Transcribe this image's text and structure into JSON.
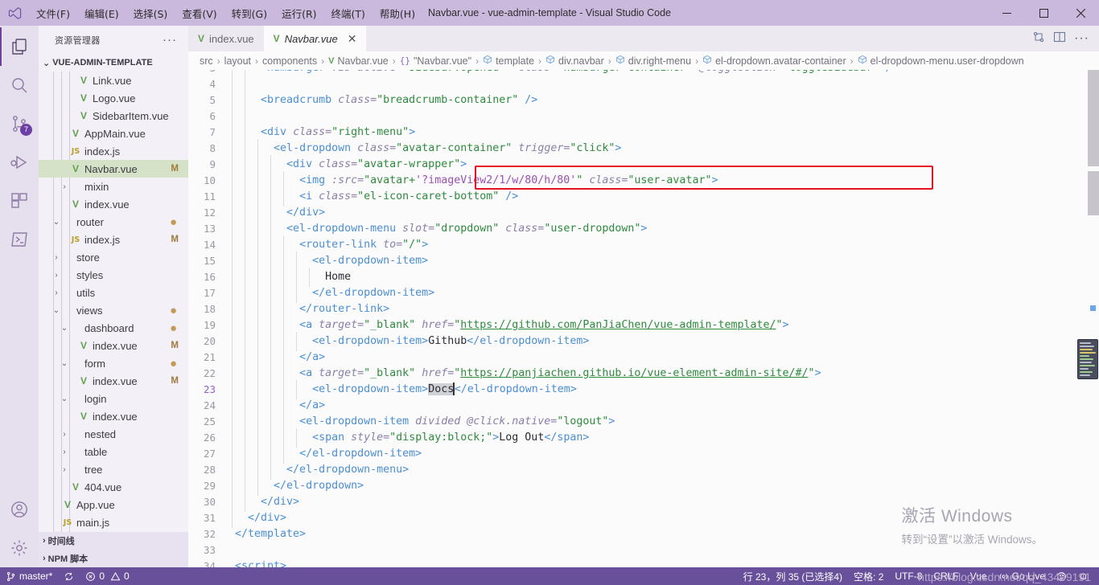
{
  "window": {
    "title": "Navbar.vue - vue-admin-template - Visual Studio Code",
    "minimize_label": "–",
    "maximize_label": "❐",
    "close_label": "✕"
  },
  "menubar": {
    "items": [
      {
        "label": "文件(F)"
      },
      {
        "label": "编辑(E)"
      },
      {
        "label": "选择(S)"
      },
      {
        "label": "查看(V)"
      },
      {
        "label": "转到(G)"
      },
      {
        "label": "运行(R)"
      },
      {
        "label": "终端(T)"
      },
      {
        "label": "帮助(H)"
      }
    ]
  },
  "activitybar": {
    "items": [
      {
        "name": "explorer-icon",
        "badge": ""
      },
      {
        "name": "search-icon",
        "badge": ""
      },
      {
        "name": "source-control-icon",
        "badge": "7"
      },
      {
        "name": "run-debug-icon",
        "badge": ""
      },
      {
        "name": "extensions-icon",
        "badge": ""
      },
      {
        "name": "remote-terminal-icon",
        "badge": ""
      }
    ],
    "bottom": [
      {
        "name": "accounts-icon"
      },
      {
        "name": "settings-gear-icon"
      }
    ]
  },
  "sidebar": {
    "header": "资源管理器",
    "header_more": "···",
    "project": "VUE-ADMIN-TEMPLATE",
    "tree": [
      {
        "label": "Link.vue",
        "icon": "vue",
        "indent": 3,
        "twisty": "",
        "status": "",
        "selected": false
      },
      {
        "label": "Logo.vue",
        "icon": "vue",
        "indent": 3,
        "twisty": "",
        "status": "",
        "selected": false
      },
      {
        "label": "SidebarItem.vue",
        "icon": "vue",
        "indent": 3,
        "twisty": "",
        "status": "",
        "selected": false
      },
      {
        "label": "AppMain.vue",
        "icon": "vue",
        "indent": 2,
        "twisty": "",
        "status": "",
        "selected": false
      },
      {
        "label": "index.js",
        "icon": "js",
        "indent": 2,
        "twisty": "",
        "status": "",
        "selected": false
      },
      {
        "label": "Navbar.vue",
        "icon": "vue",
        "indent": 2,
        "twisty": "",
        "status": "M",
        "selected": true
      },
      {
        "label": "mixin",
        "icon": "",
        "indent": 2,
        "twisty": ">",
        "status": "",
        "selected": false
      },
      {
        "label": "index.vue",
        "icon": "vue",
        "indent": 2,
        "twisty": "",
        "status": "",
        "selected": false
      },
      {
        "label": "router",
        "icon": "",
        "indent": 1,
        "twisty": "v",
        "status": "●",
        "selected": false
      },
      {
        "label": "index.js",
        "icon": "js",
        "indent": 2,
        "twisty": "",
        "status": "M",
        "selected": false
      },
      {
        "label": "store",
        "icon": "",
        "indent": 1,
        "twisty": ">",
        "status": "",
        "selected": false
      },
      {
        "label": "styles",
        "icon": "",
        "indent": 1,
        "twisty": ">",
        "status": "",
        "selected": false
      },
      {
        "label": "utils",
        "icon": "",
        "indent": 1,
        "twisty": ">",
        "status": "",
        "selected": false
      },
      {
        "label": "views",
        "icon": "",
        "indent": 1,
        "twisty": "v",
        "status": "●",
        "selected": false
      },
      {
        "label": "dashboard",
        "icon": "",
        "indent": 2,
        "twisty": "v",
        "status": "●",
        "selected": false
      },
      {
        "label": "index.vue",
        "icon": "vue",
        "indent": 3,
        "twisty": "",
        "status": "M",
        "selected": false
      },
      {
        "label": "form",
        "icon": "",
        "indent": 2,
        "twisty": "v",
        "status": "●",
        "selected": false
      },
      {
        "label": "index.vue",
        "icon": "vue",
        "indent": 3,
        "twisty": "",
        "status": "M",
        "selected": false
      },
      {
        "label": "login",
        "icon": "",
        "indent": 2,
        "twisty": "v",
        "status": "",
        "selected": false
      },
      {
        "label": "index.vue",
        "icon": "vue",
        "indent": 3,
        "twisty": "",
        "status": "",
        "selected": false
      },
      {
        "label": "nested",
        "icon": "",
        "indent": 2,
        "twisty": ">",
        "status": "",
        "selected": false
      },
      {
        "label": "table",
        "icon": "",
        "indent": 2,
        "twisty": ">",
        "status": "",
        "selected": false
      },
      {
        "label": "tree",
        "icon": "",
        "indent": 2,
        "twisty": ">",
        "status": "",
        "selected": false
      },
      {
        "label": "404.vue",
        "icon": "vue",
        "indent": 2,
        "twisty": "",
        "status": "",
        "selected": false
      },
      {
        "label": "App.vue",
        "icon": "vue",
        "indent": 1,
        "twisty": "",
        "status": "",
        "selected": false
      },
      {
        "label": "main.js",
        "icon": "js",
        "indent": 1,
        "twisty": "",
        "status": "",
        "selected": false
      }
    ],
    "sections_bottom": [
      {
        "label": "时间线",
        "twisty": ">"
      },
      {
        "label": "NPM 脚本",
        "twisty": ">"
      }
    ]
  },
  "tabs": {
    "items": [
      {
        "label": "index.vue",
        "icon": "vue",
        "active": false,
        "closable": false
      },
      {
        "label": "Navbar.vue",
        "icon": "vue",
        "active": true,
        "closable": true,
        "close": "✕"
      }
    ],
    "actions": [
      {
        "name": "split-compare-icon"
      },
      {
        "name": "split-editor-icon"
      },
      {
        "name": "editor-more-actions",
        "label": "···"
      }
    ]
  },
  "breadcrumbs": {
    "sep": "›",
    "items": [
      {
        "label": "src",
        "sym": ""
      },
      {
        "label": "layout",
        "sym": ""
      },
      {
        "label": "components",
        "sym": ""
      },
      {
        "label": "Navbar.vue",
        "sym": "vue"
      },
      {
        "label": "\"Navbar.vue\"",
        "sym": "brace"
      },
      {
        "label": "template",
        "sym": "cube"
      },
      {
        "label": "div.navbar",
        "sym": "cube"
      },
      {
        "label": "div.right-menu",
        "sym": "cube"
      },
      {
        "label": "el-dropdown.avatar-container",
        "sym": "cube"
      },
      {
        "label": "el-dropdown-menu.user-dropdown",
        "sym": "cube"
      }
    ]
  },
  "editor": {
    "first_visible_line": 3,
    "highlight_box": {
      "line": 10,
      "label": "highlighted-img-line"
    },
    "lines": [
      {
        "n": 3,
        "indent": 2,
        "partial": true,
        "tokens": [
          {
            "t": "<hamburger ",
            "c": "kw-tag"
          },
          {
            "t": ":is-active=",
            "c": "kw-attr"
          },
          {
            "t": "\"sidebar.opened\"",
            "c": "kw-str"
          },
          {
            "t": "  ",
            "c": "kw-text"
          },
          {
            "t": "class=",
            "c": "kw-attr"
          },
          {
            "t": "\"hamburger-container\"",
            "c": "kw-str"
          },
          {
            "t": " ",
            "c": "kw-text"
          },
          {
            "t": "@toggleClick=",
            "c": "kw-attr"
          },
          {
            "t": "\"toggleSidebar\"",
            "c": "kw-str"
          },
          {
            "t": " />",
            "c": "kw-tag"
          }
        ]
      },
      {
        "n": 4,
        "indent": 2,
        "tokens": []
      },
      {
        "n": 5,
        "indent": 2,
        "tokens": [
          {
            "t": "<breadcrumb ",
            "c": "kw-tag"
          },
          {
            "t": "class=",
            "c": "kw-attr"
          },
          {
            "t": "\"breadcrumb-container\"",
            "c": "kw-str"
          },
          {
            "t": " />",
            "c": "kw-tag"
          }
        ]
      },
      {
        "n": 6,
        "indent": 2,
        "tokens": []
      },
      {
        "n": 7,
        "indent": 2,
        "tokens": [
          {
            "t": "<div ",
            "c": "kw-tag"
          },
          {
            "t": "class=",
            "c": "kw-attr"
          },
          {
            "t": "\"right-menu\"",
            "c": "kw-str"
          },
          {
            "t": ">",
            "c": "kw-tag"
          }
        ]
      },
      {
        "n": 8,
        "indent": 3,
        "tokens": [
          {
            "t": "<el-dropdown ",
            "c": "kw-tag"
          },
          {
            "t": "class=",
            "c": "kw-attr"
          },
          {
            "t": "\"avatar-container\"",
            "c": "kw-str"
          },
          {
            "t": " ",
            "c": "kw-text"
          },
          {
            "t": "trigger=",
            "c": "kw-attr"
          },
          {
            "t": "\"click\"",
            "c": "kw-str"
          },
          {
            "t": ">",
            "c": "kw-tag"
          }
        ]
      },
      {
        "n": 9,
        "indent": 4,
        "tokens": [
          {
            "t": "<div ",
            "c": "kw-tag"
          },
          {
            "t": "class=",
            "c": "kw-attr"
          },
          {
            "t": "\"avatar-wrapper\"",
            "c": "kw-str"
          },
          {
            "t": ">",
            "c": "kw-tag"
          }
        ]
      },
      {
        "n": 10,
        "indent": 5,
        "tokens": [
          {
            "t": "<img ",
            "c": "kw-tag"
          },
          {
            "t": ":src=",
            "c": "kw-attr"
          },
          {
            "t": "\"avatar+",
            "c": "kw-str"
          },
          {
            "t": "'?imageView2/1/w/80/h/80'",
            "c": "kw-purple"
          },
          {
            "t": "\"",
            "c": "kw-str"
          },
          {
            "t": " ",
            "c": "kw-text"
          },
          {
            "t": "class=",
            "c": "kw-attr"
          },
          {
            "t": "\"user-avatar\"",
            "c": "kw-str"
          },
          {
            "t": ">",
            "c": "kw-tag"
          }
        ]
      },
      {
        "n": 11,
        "indent": 5,
        "tokens": [
          {
            "t": "<i ",
            "c": "kw-tag"
          },
          {
            "t": "class=",
            "c": "kw-attr"
          },
          {
            "t": "\"el-icon-caret-bottom\"",
            "c": "kw-str"
          },
          {
            "t": " />",
            "c": "kw-tag"
          }
        ]
      },
      {
        "n": 12,
        "indent": 4,
        "tokens": [
          {
            "t": "</div>",
            "c": "kw-tag"
          }
        ]
      },
      {
        "n": 13,
        "indent": 4,
        "tokens": [
          {
            "t": "<el-dropdown-menu ",
            "c": "kw-tag"
          },
          {
            "t": "slot=",
            "c": "kw-attr"
          },
          {
            "t": "\"dropdown\"",
            "c": "kw-str"
          },
          {
            "t": " ",
            "c": "kw-text"
          },
          {
            "t": "class=",
            "c": "kw-attr"
          },
          {
            "t": "\"user-dropdown\"",
            "c": "kw-str"
          },
          {
            "t": ">",
            "c": "kw-tag"
          }
        ]
      },
      {
        "n": 14,
        "indent": 5,
        "tokens": [
          {
            "t": "<router-link ",
            "c": "kw-tag"
          },
          {
            "t": "to=",
            "c": "kw-attr"
          },
          {
            "t": "\"/\"",
            "c": "kw-str"
          },
          {
            "t": ">",
            "c": "kw-tag"
          }
        ]
      },
      {
        "n": 15,
        "indent": 6,
        "tokens": [
          {
            "t": "<el-dropdown-item>",
            "c": "kw-tag"
          }
        ]
      },
      {
        "n": 16,
        "indent": 7,
        "tokens": [
          {
            "t": "Home",
            "c": "kw-text"
          }
        ]
      },
      {
        "n": 17,
        "indent": 6,
        "tokens": [
          {
            "t": "</el-dropdown-item>",
            "c": "kw-tag"
          }
        ]
      },
      {
        "n": 18,
        "indent": 5,
        "tokens": [
          {
            "t": "</router-link>",
            "c": "kw-tag"
          }
        ]
      },
      {
        "n": 19,
        "indent": 5,
        "tokens": [
          {
            "t": "<a ",
            "c": "kw-tag"
          },
          {
            "t": "target=",
            "c": "kw-attr"
          },
          {
            "t": "\"_blank\"",
            "c": "kw-str"
          },
          {
            "t": " ",
            "c": "kw-text"
          },
          {
            "t": "href=",
            "c": "kw-attr"
          },
          {
            "t": "\"",
            "c": "kw-str"
          },
          {
            "t": "https://github.com/PanJiaChen/vue-admin-template/",
            "c": "kw-link"
          },
          {
            "t": "\"",
            "c": "kw-str"
          },
          {
            "t": ">",
            "c": "kw-tag"
          }
        ]
      },
      {
        "n": 20,
        "indent": 6,
        "tokens": [
          {
            "t": "<el-dropdown-item>",
            "c": "kw-tag"
          },
          {
            "t": "Github",
            "c": "kw-text"
          },
          {
            "t": "</el-dropdown-item>",
            "c": "kw-tag"
          }
        ]
      },
      {
        "n": 21,
        "indent": 5,
        "tokens": [
          {
            "t": "</a>",
            "c": "kw-tag"
          }
        ]
      },
      {
        "n": 22,
        "indent": 5,
        "tokens": [
          {
            "t": "<a ",
            "c": "kw-tag"
          },
          {
            "t": "target=",
            "c": "kw-attr"
          },
          {
            "t": "\"_blank\"",
            "c": "kw-str"
          },
          {
            "t": " ",
            "c": "kw-text"
          },
          {
            "t": "href=",
            "c": "kw-attr"
          },
          {
            "t": "\"",
            "c": "kw-str"
          },
          {
            "t": "https://panjiachen.github.io/vue-element-admin-site/#/",
            "c": "kw-link"
          },
          {
            "t": "\"",
            "c": "kw-str"
          },
          {
            "t": ">",
            "c": "kw-tag"
          }
        ]
      },
      {
        "n": 23,
        "indent": 6,
        "current": true,
        "tokens": [
          {
            "t": "<el-dropdown-item>",
            "c": "kw-tag"
          },
          {
            "t": "Docs",
            "c": "kw-text sel"
          },
          {
            "t": "│",
            "c": "cursor-token"
          },
          {
            "t": "</el-dropdown-item>",
            "c": "kw-tag"
          }
        ]
      },
      {
        "n": 24,
        "indent": 5,
        "tokens": [
          {
            "t": "</a>",
            "c": "kw-tag"
          }
        ]
      },
      {
        "n": 25,
        "indent": 5,
        "tokens": [
          {
            "t": "<el-dropdown-item ",
            "c": "kw-tag"
          },
          {
            "t": "divided",
            "c": "kw-attr"
          },
          {
            "t": " ",
            "c": "kw-text"
          },
          {
            "t": "@click.native=",
            "c": "kw-attr"
          },
          {
            "t": "\"logout\"",
            "c": "kw-str"
          },
          {
            "t": ">",
            "c": "kw-tag"
          }
        ]
      },
      {
        "n": 26,
        "indent": 6,
        "tokens": [
          {
            "t": "<span ",
            "c": "kw-tag"
          },
          {
            "t": "style=",
            "c": "kw-attr"
          },
          {
            "t": "\"display:block;\"",
            "c": "kw-str"
          },
          {
            "t": ">",
            "c": "kw-tag"
          },
          {
            "t": "Log Out",
            "c": "kw-text"
          },
          {
            "t": "</span>",
            "c": "kw-tag"
          }
        ]
      },
      {
        "n": 27,
        "indent": 5,
        "tokens": [
          {
            "t": "</el-dropdown-item>",
            "c": "kw-tag"
          }
        ]
      },
      {
        "n": 28,
        "indent": 4,
        "tokens": [
          {
            "t": "</el-dropdown-menu>",
            "c": "kw-tag"
          }
        ]
      },
      {
        "n": 29,
        "indent": 3,
        "tokens": [
          {
            "t": "</el-dropdown>",
            "c": "kw-tag"
          }
        ]
      },
      {
        "n": 30,
        "indent": 2,
        "tokens": [
          {
            "t": "</div>",
            "c": "kw-tag"
          }
        ]
      },
      {
        "n": 31,
        "indent": 1,
        "tokens": [
          {
            "t": "</div>",
            "c": "kw-tag"
          }
        ]
      },
      {
        "n": 32,
        "indent": 0,
        "tokens": [
          {
            "t": "</template>",
            "c": "kw-tag"
          }
        ]
      },
      {
        "n": 33,
        "indent": 0,
        "tokens": []
      },
      {
        "n": 34,
        "indent": 0,
        "partial_bottom": true,
        "tokens": [
          {
            "t": "<script>",
            "c": "kw-tag"
          }
        ]
      }
    ]
  },
  "watermark": {
    "line1": "激活 Windows",
    "line2": "转到“设置”以激活 Windows。"
  },
  "url_overlay": "https://blog.csdn.net/qq_43499191",
  "statusbar": {
    "left": [
      {
        "name": "branch",
        "icon": "source-control-icon",
        "label": "master*"
      },
      {
        "name": "sync",
        "icon": "sync-icon",
        "label": ""
      },
      {
        "name": "problems",
        "icon": "error-warning-icon",
        "label": "0  0",
        "errors": "0",
        "warnings": "0"
      }
    ],
    "right": [
      {
        "name": "cursor-position",
        "label": "行 23，列 35 (已选择4)"
      },
      {
        "name": "indentation",
        "label": "空格: 2"
      },
      {
        "name": "encoding",
        "label": "UTF-8"
      },
      {
        "name": "eol",
        "label": "CRLF"
      },
      {
        "name": "language-mode",
        "label": "Vue"
      },
      {
        "name": "go-live",
        "label": "Go Live",
        "icon": "broadcast-icon"
      },
      {
        "name": "feedback",
        "label": "",
        "icon": "smiley-icon"
      },
      {
        "name": "notifications",
        "label": "",
        "icon": "bell-icon"
      }
    ]
  },
  "colors": {
    "titlebar": "#cbb8dd",
    "statusbar": "#68509a",
    "accent": "#6c3fa4",
    "highlight_box": "#e81123",
    "selection": "#cfd2d6",
    "tree_selected": "#d6e2c8"
  }
}
